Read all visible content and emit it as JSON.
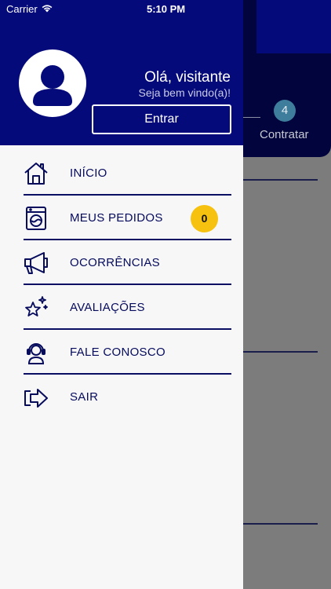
{
  "status_bar": {
    "carrier": "Carrier",
    "time": "5:10 PM"
  },
  "drawer": {
    "greeting": "Olá, visitante",
    "subgreeting": "Seja bem vindo(a)!",
    "enter_label": "Entrar",
    "avatar_icon": "user-avatar-icon"
  },
  "menu": {
    "items": [
      {
        "label": "INÍCIO",
        "icon": "home-icon"
      },
      {
        "label": "MEUS PEDIDOS",
        "icon": "washing-machine-icon",
        "badge": "0"
      },
      {
        "label": "OCORRÊNCIAS",
        "icon": "megaphone-icon"
      },
      {
        "label": "AVALIAÇÕES",
        "icon": "star-sparkle-icon"
      },
      {
        "label": "FALE CONOSCO",
        "icon": "headset-icon"
      },
      {
        "label": "SAIR",
        "icon": "exit-arrow-icon"
      }
    ]
  },
  "background": {
    "step_number": "4",
    "step_label": "Contratar"
  },
  "colors": {
    "drawer_header": "#050a7a",
    "menu_text": "#060b5c",
    "badge": "#f6c10f",
    "app_header": "#02053d"
  }
}
